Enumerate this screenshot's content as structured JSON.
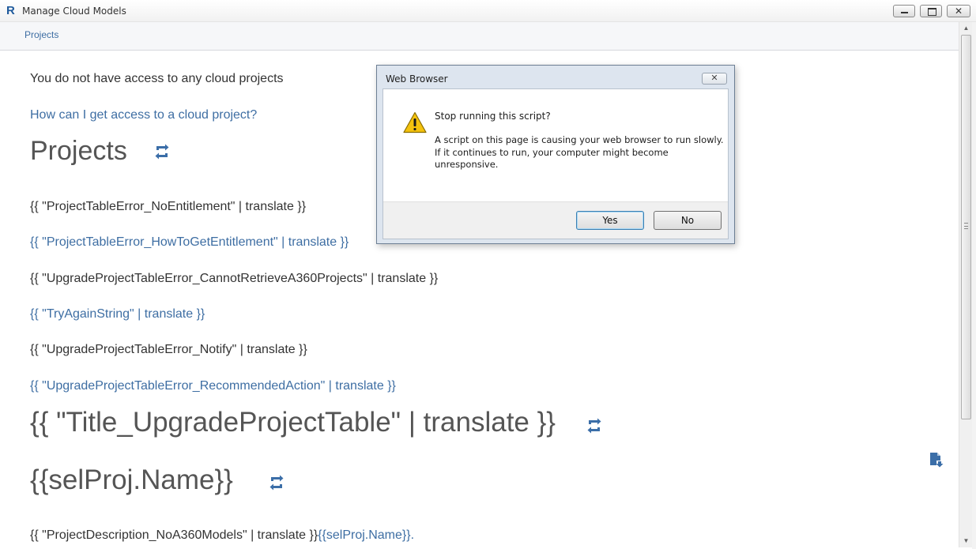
{
  "window": {
    "icon_letter": "R",
    "title": "Manage Cloud Models",
    "close_glyph": "✕"
  },
  "breadcrumb": {
    "label": "Projects"
  },
  "content": {
    "no_access": "You do not have access to any cloud projects",
    "how_access": "How can I get access to a cloud project?",
    "projects_heading": "Projects",
    "error_no_entitlement": "{{ \"ProjectTableError_NoEntitlement\" | translate }}",
    "error_how_to": "{{ \"ProjectTableError_HowToGetEntitlement\" | translate }}",
    "error_cannot_retrieve": "{{ \"UpgradeProjectTableError_CannotRetrieveA360Projects\" | translate }}",
    "try_again": "{{ \"TryAgainString\" | translate }}",
    "upgrade_notify": "{{ \"UpgradeProjectTableError_Notify\" | translate }}",
    "upgrade_recommended": "{{ \"UpgradeProjectTableError_RecommendedAction\" | translate }}",
    "upgrade_title": "{{ \"Title_UpgradeProjectTable\" | translate }}",
    "selproj_heading": "{{selProj.Name}}",
    "description_prefix": "{{ \"ProjectDescription_NoA360Models\" | translate }}",
    "description_link": "{{selProj.Name}}."
  },
  "dialog": {
    "title": "Web Browser",
    "close_glyph": "✕",
    "heading": "Stop running this script?",
    "message_lines": [
      "A script on this page is causing your web browser to run slowly.",
      "If it continues to run, your computer might become",
      "unresponsive."
    ],
    "yes_label": "Yes",
    "no_label": "No"
  },
  "icons": {
    "refresh": "refresh-icon",
    "document": "document-download-icon",
    "warning": "warning-icon"
  },
  "colors": {
    "link": "#3e6ea3",
    "text": "#333333",
    "icon_blue": "#3b6ea8"
  }
}
